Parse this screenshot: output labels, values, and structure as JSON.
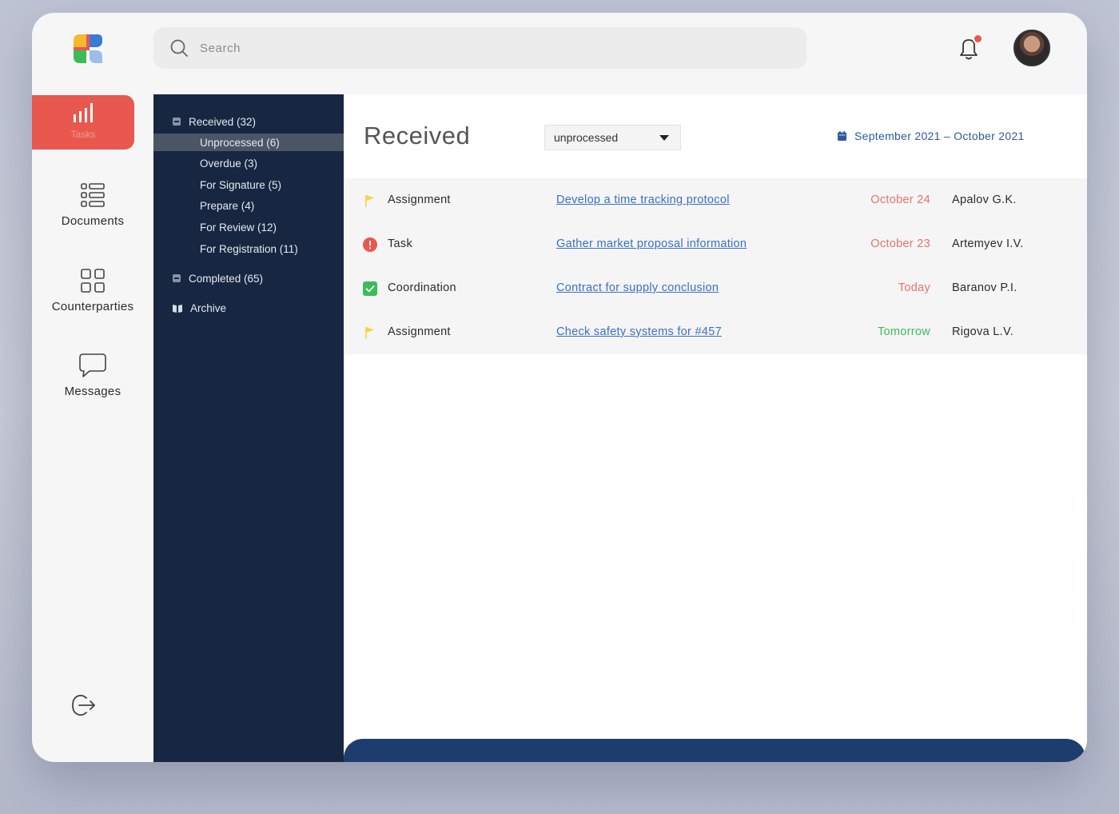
{
  "search": {
    "placeholder": "Search"
  },
  "rail": {
    "active_label": "Tasks",
    "items": [
      {
        "label": "Documents",
        "icon": "list-icon"
      },
      {
        "label": "Counterparties",
        "icon": "grid-icon"
      },
      {
        "label": "Messages",
        "icon": "chat-icon"
      }
    ]
  },
  "folders": {
    "received": "Received (32)",
    "subfolders": [
      "Unprocessed (6)",
      "Overdue (3)",
      "For Signature (5)",
      "Prepare (4)",
      "For Review (12)",
      "For Registration (11)"
    ],
    "completed": "Completed (65)",
    "archive": "Archive"
  },
  "main": {
    "title": "Received",
    "filter_value": "unprocessed",
    "date_range": "September 2021 – October 2021"
  },
  "rows": [
    {
      "type": "Assignment",
      "icon": "flag-icon",
      "subject": "Develop a time tracking protocol",
      "due": "October 24",
      "due_color": "#e8726a",
      "person": "Apalov G.K."
    },
    {
      "type": "Task",
      "icon": "alert-icon",
      "subject": "Gather market proposal information",
      "due": "October 23",
      "due_color": "#e8726a",
      "person": "Artemyev I.V."
    },
    {
      "type": "Coordination",
      "icon": "check-icon",
      "subject": "Contract for supply conclusion",
      "due": "Today",
      "due_color": "#e8726a",
      "person": "Baranov P.I."
    },
    {
      "type": "Assignment",
      "icon": "flag-icon",
      "subject": "Check safety systems for #457",
      "due": "Tomorrow",
      "due_color": "#3dbb5a",
      "person": "Rigova L.V."
    }
  ],
  "colors": {
    "accent": "#e8584e",
    "sidebar_bg": "#172742",
    "link": "#3a6fc4",
    "flag": "#f5d547",
    "alert": "#e8584e",
    "check": "#3dbb5a"
  }
}
